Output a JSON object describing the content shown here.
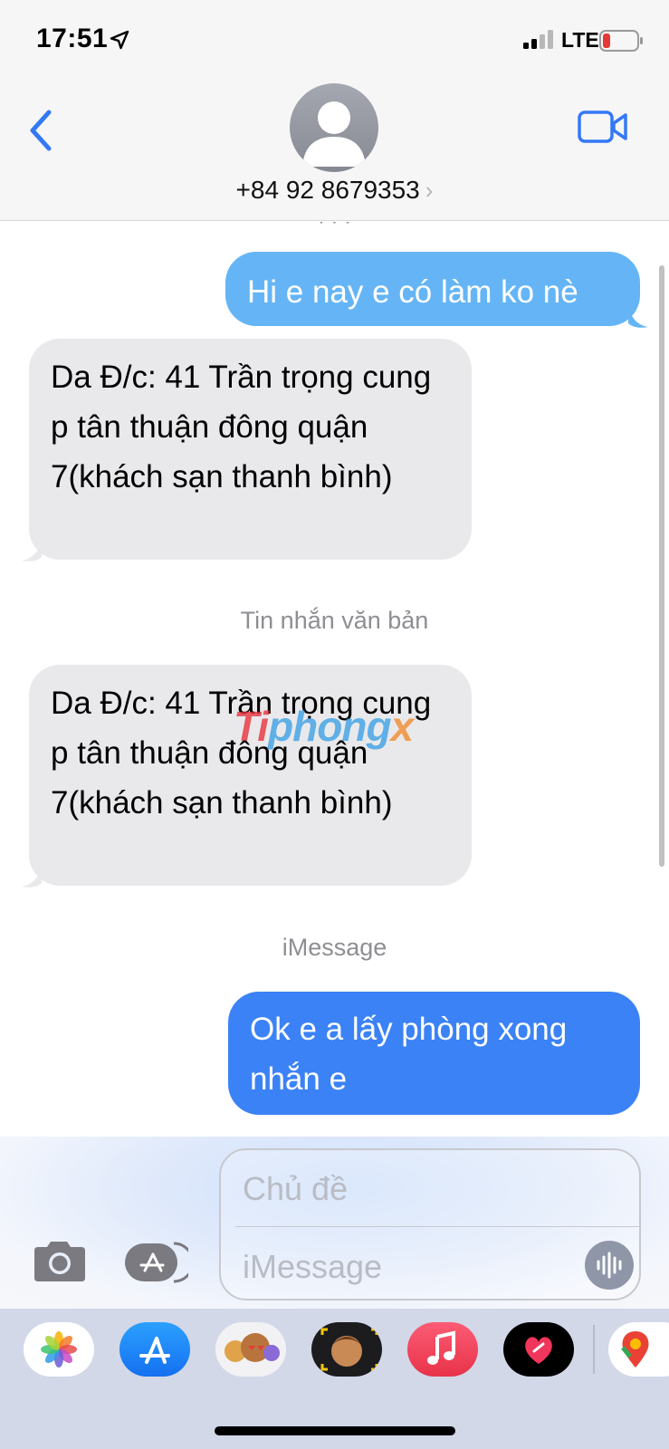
{
  "status_bar": {
    "time": "17:51",
    "network": "LTE",
    "icons": [
      "location-arrow-icon",
      "signal-bars-icon",
      "battery-low-icon"
    ],
    "battery_color": "#e53935"
  },
  "header": {
    "contact": "+84 92 8679353",
    "chevron": "›",
    "back_icon": "chevron-left-icon",
    "video_icon": "facetime-video-icon"
  },
  "conversation": {
    "cut_timestamp": "· · ·",
    "messages": [
      {
        "type": "sms-outgoing",
        "text": "Hi e nay e có làm ko nè"
      },
      {
        "type": "incoming",
        "text": "Da Đ/c: 41 Trần trọng cung p tân thuận đông quận 7(khách sạn thanh bình)"
      },
      {
        "type": "service-label",
        "text": "Tin nhắn văn bản"
      },
      {
        "type": "incoming",
        "text": "Da Đ/c: 41 Trần trọng cung p tân thuận đông quận 7(khách sạn thanh bình)"
      },
      {
        "type": "service-label",
        "text": "iMessage"
      },
      {
        "type": "imessage-outgoing",
        "text": "Ok e a lấy phòng xong nhắn e"
      }
    ],
    "watermark": {
      "part1": "Ti",
      "part2": "phong",
      "part3": "x"
    }
  },
  "input": {
    "subject_placeholder": "Chủ đề",
    "message_placeholder": "iMessage",
    "camera_icon": "camera-icon",
    "apps_icon": "app-store-icon",
    "audio_icon": "audio-waveform-icon"
  },
  "app_drawer": {
    "apps": [
      "Photos",
      "App Store",
      "Memoji Stickers",
      "Memoji",
      "Music",
      "Digital Touch",
      "Maps"
    ]
  },
  "colors": {
    "sms_bubble": "#65b5f6",
    "imessage_bubble": "#3b82f6",
    "incoming_bubble": "#e9e9eb",
    "tint": "#3478f6"
  }
}
